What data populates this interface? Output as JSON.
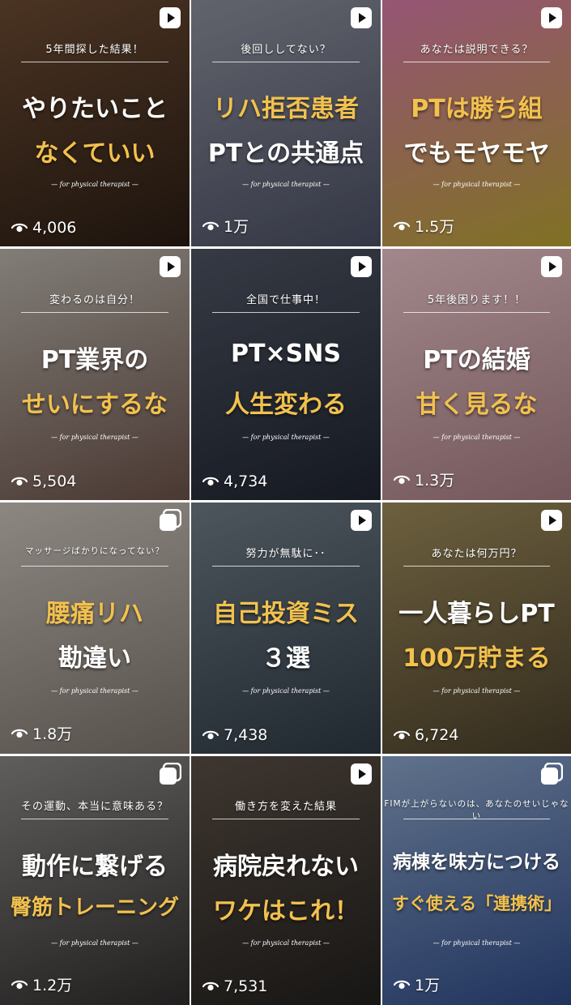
{
  "tiles": [
    {
      "caption": "5年間探した結果！",
      "line1": "やりたいこと",
      "line2": "なくていい",
      "line1_color": "white",
      "line2_color": "gold",
      "sub": "— for physical therapist —",
      "views": "4,006",
      "badge": "reel",
      "bg": [
        "#6b4a32",
        "#2a1d14"
      ]
    },
    {
      "caption": "後回ししてない？",
      "line1": "リハ拒否患者",
      "line2": "PTとの共通点",
      "line1_color": "gold",
      "line2_color": "white",
      "sub": "— for physical therapist —",
      "views": "1万",
      "badge": "reel",
      "bg": [
        "#8c8f9c",
        "#4b4f63"
      ]
    },
    {
      "caption": "あなたは説明できる？",
      "line1": "PTは勝ち組",
      "line2": "でもモヤモヤ",
      "line1_color": "gold",
      "line2_color": "white",
      "sub": "— for physical therapist —",
      "views": "1.5万",
      "badge": "reel",
      "bg": [
        "#d77aa8",
        "#b7a233"
      ]
    },
    {
      "caption": "変わるのは自分！",
      "line1": "PT業界の",
      "line2": "せいにするな",
      "line1_color": "white",
      "line2_color": "gold",
      "sub": "— for physical therapist —",
      "views": "5,504",
      "badge": "reel",
      "bg": [
        "#b9b4ab",
        "#6b5149"
      ]
    },
    {
      "caption": "全国で仕事中！",
      "line1": "PT×SNS",
      "line2": "人生変わる",
      "line1_color": "white",
      "line2_color": "gold",
      "sub": "— for physical therapist —",
      "views": "4,734",
      "badge": "reel",
      "bg": [
        "#4d5462",
        "#1f2430"
      ]
    },
    {
      "caption": "5年後困ります！！",
      "line1": "PTの結婚",
      "line2": "甘く見るな",
      "line1_color": "white",
      "line2_color": "gold",
      "sub": "— for physical therapist —",
      "views": "1.3万",
      "badge": "reel",
      "bg": [
        "#e8c2c8",
        "#a57d82"
      ]
    },
    {
      "caption": "マッサージばかりになってない？",
      "line1": "腰痛リハ",
      "line2": "勘違い",
      "line1_color": "gold",
      "line2_color": "white",
      "sub": "— for physical therapist —",
      "views": "1.8万",
      "badge": "multi",
      "bg": [
        "#c9c2ba",
        "#7d746d"
      ]
    },
    {
      "caption": "努力が無駄に･･",
      "line1": "自己投資ミス",
      "line2": "３選",
      "line1_color": "gold",
      "line2_color": "white",
      "sub": "— for physical therapist —",
      "views": "7,438",
      "badge": "reel",
      "bg": [
        "#6f7b86",
        "#2f3a44"
      ]
    },
    {
      "caption": "あなたは何万円？",
      "line1": "一人暮らしPT",
      "line2": "100万貯まる",
      "line1_color": "white",
      "line2_color": "gold",
      "sub": "— for physical therapist —",
      "views": "6,724",
      "badge": "reel",
      "bg": [
        "#9c8a5a",
        "#4a3f2b"
      ]
    },
    {
      "caption": "その運動、本当に意味ある？",
      "line1": "動作に繋げる",
      "line2": "臀筋トレーニング",
      "line1_color": "white",
      "line2_color": "gold",
      "sub": "— for physical therapist —",
      "views": "1.2万",
      "badge": "multi",
      "bg": [
        "#8a8785",
        "#2f2d2c"
      ]
    },
    {
      "caption": "働き方を変えた結果",
      "line1": "病院戻れない",
      "line2": "ワケはこれ！",
      "line1_color": "white",
      "line2_color": "gold",
      "sub": "— for physical therapist —",
      "views": "7,531",
      "badge": "reel",
      "bg": [
        "#5a4e45",
        "#22201e"
      ]
    },
    {
      "caption": "FIMが上がらないのは、あなたのせいじゃない",
      "line1": "病棟を味方につける",
      "line2": "すぐ使える「連携術」",
      "line1_color": "white",
      "line2_color": "gold",
      "sub": "— for physical therapist —",
      "views": "1万",
      "badge": "multi",
      "bg": [
        "#8aa3c7",
        "#2f4a86"
      ]
    }
  ]
}
